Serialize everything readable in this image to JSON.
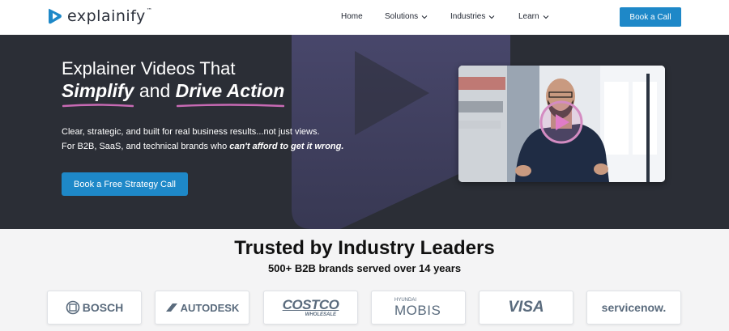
{
  "header": {
    "brand": "explainify",
    "brand_mark": "™",
    "nav": [
      {
        "label": "Home",
        "has_dropdown": false
      },
      {
        "label": "Solutions",
        "has_dropdown": true
      },
      {
        "label": "Industries",
        "has_dropdown": true
      },
      {
        "label": "Learn",
        "has_dropdown": true
      }
    ],
    "cta_label": "Book a Call"
  },
  "hero": {
    "title_line1": "Explainer Videos That",
    "title_word1": "Simplify",
    "title_and": " and ",
    "title_word2": "Drive Action",
    "paragraph_line1": "Clear, strategic, and built for real business results...not just views.",
    "paragraph_line2_start": "For B2B, SaaS, and technical brands who ",
    "paragraph_line2_emphasis": "can't afford to get it wrong.",
    "cta_label": "Book a Free Strategy Call"
  },
  "trusted": {
    "title": "Trusted by Industry Leaders",
    "subtitle": "500+ B2B brands served over 14 years",
    "logos": [
      {
        "name": "BOSCH"
      },
      {
        "name": "AUTODESK"
      },
      {
        "name": "COSTCO",
        "sub": "WHOLESALE"
      },
      {
        "name": "MOBIS",
        "sub": "HYUNDAI"
      },
      {
        "name": "VISA"
      },
      {
        "name": "servicenow."
      }
    ]
  },
  "colors": {
    "accent": "#1e88c8",
    "hero_bg": "#2b2e36",
    "highlight": "#c86ab4"
  }
}
